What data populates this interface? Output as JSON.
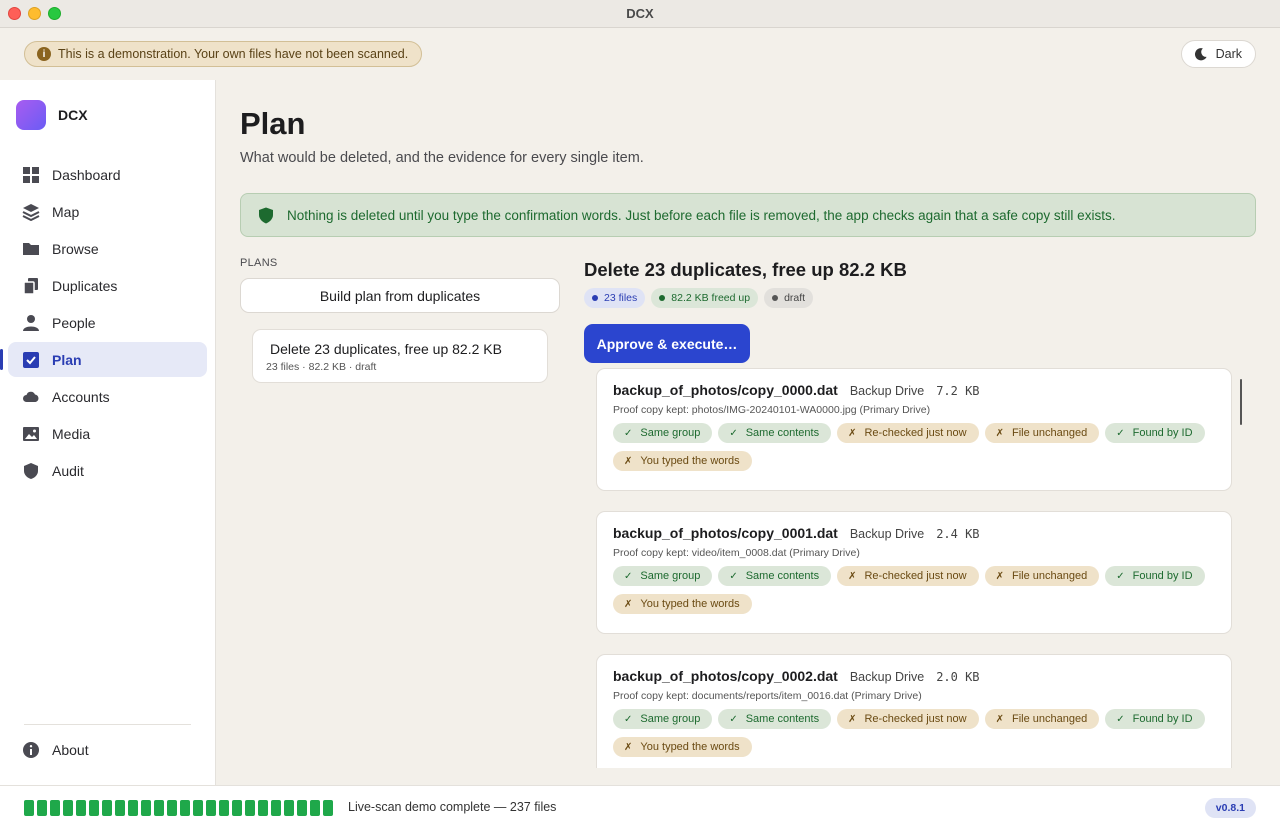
{
  "window": {
    "title": "DCX"
  },
  "topbar": {
    "demo_banner": "This is a demonstration. Your own files have not been scanned.",
    "theme_label": "Dark"
  },
  "sidebar": {
    "brand": "DCX",
    "items": [
      {
        "label": "Dashboard",
        "icon": "grid-icon"
      },
      {
        "label": "Map",
        "icon": "layers-icon"
      },
      {
        "label": "Browse",
        "icon": "folder-icon"
      },
      {
        "label": "Duplicates",
        "icon": "copy-icon"
      },
      {
        "label": "People",
        "icon": "person-icon"
      },
      {
        "label": "Plan",
        "icon": "checkbox-icon",
        "active": true
      },
      {
        "label": "Accounts",
        "icon": "cloud-icon"
      },
      {
        "label": "Media",
        "icon": "image-icon"
      },
      {
        "label": "Audit",
        "icon": "shield-icon"
      }
    ],
    "about": "About"
  },
  "main": {
    "title": "Plan",
    "subtitle": "What would be deleted, and the evidence for every single item.",
    "safety_note": "Nothing is deleted until you type the confirmation words. Just before each file is removed, the app checks again that a safe copy still exists.",
    "plans_label": "PLANS",
    "build_button": "Build plan from duplicates",
    "plan_card": {
      "title": "Delete 23 duplicates, free up 82.2 KB",
      "meta": "23 files · 82.2 KB · draft"
    },
    "detail": {
      "title": "Delete 23 duplicates, free up 82.2 KB",
      "badges": [
        "23 files",
        "82.2 KB freed up",
        "draft"
      ],
      "approve_button": "Approve & execute…"
    },
    "checks": [
      {
        "label": "Same group",
        "pass": true
      },
      {
        "label": "Same contents",
        "pass": true
      },
      {
        "label": "Re-checked just now",
        "pass": false
      },
      {
        "label": "File unchanged",
        "pass": false
      },
      {
        "label": "Found by ID",
        "pass": true
      },
      {
        "label": "You typed the words",
        "pass": false
      }
    ],
    "items": [
      {
        "name": "backup_of_photos/copy_0000.dat",
        "drive": "Backup Drive",
        "size": "7.2 KB",
        "proof": "Proof copy kept: photos/IMG-20240101-WA0000.jpg (Primary Drive)"
      },
      {
        "name": "backup_of_photos/copy_0001.dat",
        "drive": "Backup Drive",
        "size": "2.4 KB",
        "proof": "Proof copy kept: video/item_0008.dat (Primary Drive)"
      },
      {
        "name": "backup_of_photos/copy_0002.dat",
        "drive": "Backup Drive",
        "size": "2.0 KB",
        "proof": "Proof copy kept: documents/reports/item_0016.dat (Primary Drive)"
      }
    ]
  },
  "statusbar": {
    "progress": 1.0,
    "text": "Live-scan demo complete — 237 files",
    "version": "v0.8.1"
  },
  "colors": {
    "accent": "#2b45cf",
    "pass": "#1d6a2f",
    "warn": "#6a4a12",
    "progress": "#1fa84a"
  }
}
